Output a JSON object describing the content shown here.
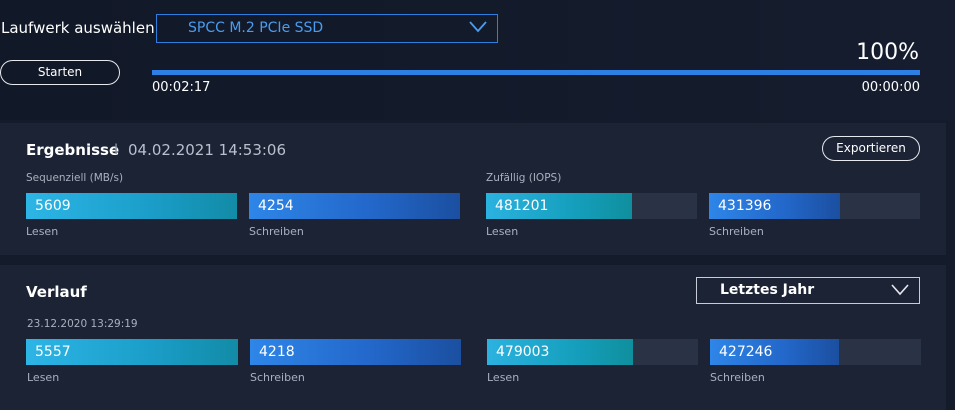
{
  "header": {
    "drive_label": "Laufwerk auswählen",
    "drive_selected": "SPCC M.2 PCIe SSD",
    "start_button": "Starten",
    "progress_percent": 100,
    "progress_text": "100%",
    "elapsed_time": "00:02:17",
    "remaining_time": "00:00:00"
  },
  "results": {
    "title": "Ergebnisse",
    "separator": "I",
    "timestamp": "04.02.2021 14:53:06",
    "export_button": "Exportieren",
    "sequential_label": "Sequenziell (MB/s)",
    "random_label": "Zufällig (IOPS)",
    "bars": [
      {
        "value": "5609",
        "caption": "Lesen",
        "fill": 1.0
      },
      {
        "value": "4254",
        "caption": "Schreiben",
        "fill": 1.0
      },
      {
        "value": "481201",
        "caption": "Lesen",
        "fill": 0.69
      },
      {
        "value": "431396",
        "caption": "Schreiben",
        "fill": 0.62
      }
    ]
  },
  "history": {
    "title": "Verlauf",
    "range_selected": "Letztes Jahr",
    "timestamp": "23.12.2020 13:29:19",
    "bars": [
      {
        "value": "5557",
        "caption": "Lesen",
        "fill": 1.0
      },
      {
        "value": "4218",
        "caption": "Schreiben",
        "fill": 1.0
      },
      {
        "value": "479003",
        "caption": "Lesen",
        "fill": 0.69
      },
      {
        "value": "427246",
        "caption": "Schreiben",
        "fill": 0.61
      }
    ]
  },
  "colors": {
    "background": "#141b2b",
    "panel": "#1b2335",
    "accent_blue": "#2e7fe3",
    "accent_cyan": "#2db5e6",
    "track": "#2a3345"
  },
  "icons": {
    "drive_dropdown": "chevron-down-icon",
    "range_dropdown": "chevron-down-icon"
  }
}
